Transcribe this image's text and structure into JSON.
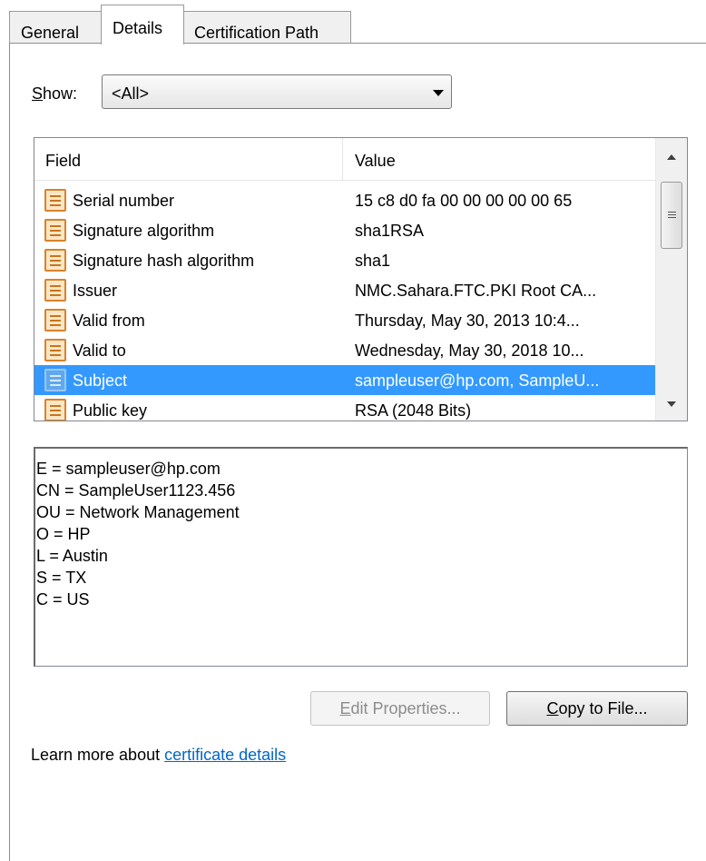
{
  "tabs": [
    {
      "label": "General",
      "active": false
    },
    {
      "label": "Details",
      "active": true
    },
    {
      "label": "Certification Path",
      "active": false
    }
  ],
  "show": {
    "label_prefix": "S",
    "label_rest": "how:",
    "selected": "<All>"
  },
  "list": {
    "columns": {
      "field": "Field",
      "value": "Value"
    },
    "rows": [
      {
        "field": "Serial number",
        "value": "15 c8 d0 fa 00 00 00 00 00 65",
        "selected": false
      },
      {
        "field": "Signature algorithm",
        "value": "sha1RSA",
        "selected": false
      },
      {
        "field": "Signature hash algorithm",
        "value": "sha1",
        "selected": false
      },
      {
        "field": "Issuer",
        "value": "NMC.Sahara.FTC.PKI Root CA...",
        "selected": false
      },
      {
        "field": "Valid from",
        "value": "Thursday, May 30, 2013 10:4...",
        "selected": false
      },
      {
        "field": "Valid to",
        "value": "Wednesday, May 30, 2018 10...",
        "selected": false
      },
      {
        "field": "Subject",
        "value": "sampleuser@hp.com, SampleU...",
        "selected": true
      },
      {
        "field": "Public key",
        "value": "RSA (2048 Bits)",
        "selected": false
      }
    ]
  },
  "detail_lines": [
    "E = sampleuser@hp.com",
    "CN = SampleUser1123.456",
    "OU = Network Management",
    "O = HP",
    "L = Austin",
    "S = TX",
    "C = US"
  ],
  "buttons": {
    "edit_prefix": "E",
    "edit_rest": "dit Properties...",
    "copy_prefix": "C",
    "copy_rest": "opy to File..."
  },
  "learn": {
    "text": "Learn more about ",
    "link": "certificate details"
  },
  "colors": {
    "selection": "#3399ff",
    "link": "#0066cc"
  }
}
